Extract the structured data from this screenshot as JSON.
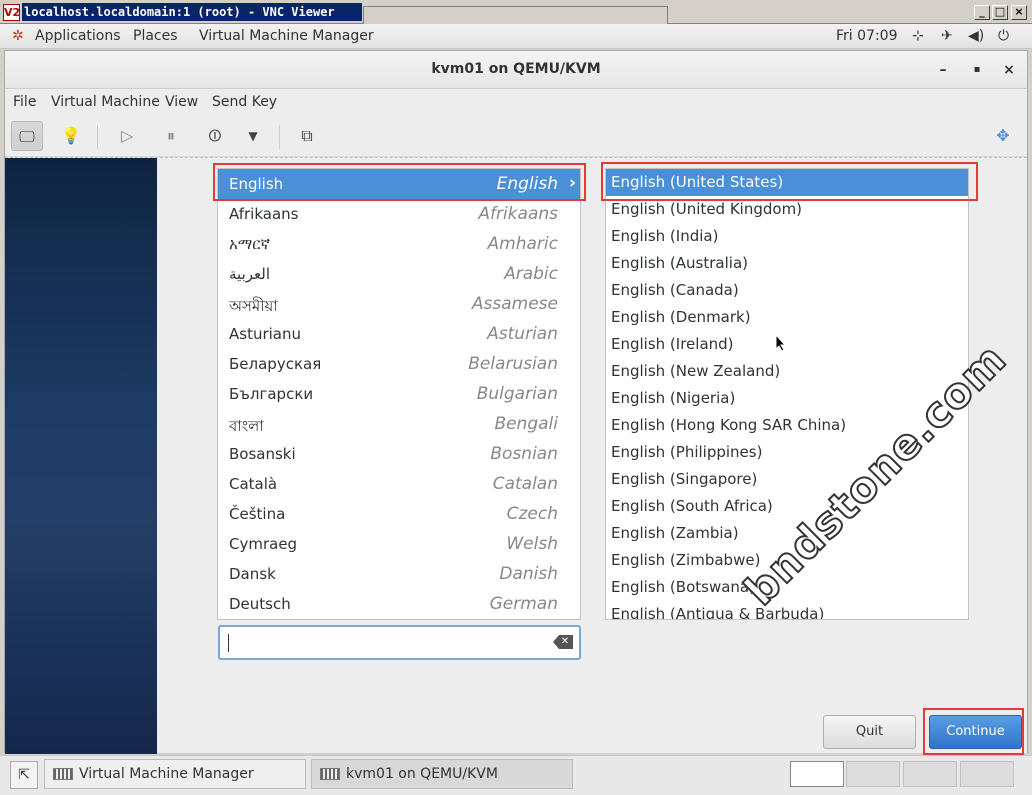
{
  "vnc": {
    "logo": "V2",
    "title": "localhost.localdomain:1 (root) - VNC Viewer",
    "controls": [
      "_",
      "□",
      "×"
    ]
  },
  "gnome_panel": {
    "applications": "Applications",
    "places": "Places",
    "virtual_machine_manager": "Virtual Machine Manager",
    "clock": "Fri 07:09",
    "icons": [
      "network-icon",
      "airplane-icon",
      "volume-icon",
      "power-icon"
    ]
  },
  "window": {
    "title": "kvm01 on QEMU/KVM",
    "controls": [
      "–",
      "▪",
      "×"
    ]
  },
  "menu": {
    "file": "File",
    "virtual_machine": "Virtual Machine",
    "view": "View",
    "send_key": "Send Key"
  },
  "languages": [
    {
      "native": "English",
      "english": "English",
      "selected": true
    },
    {
      "native": "Afrikaans",
      "english": "Afrikaans"
    },
    {
      "native": "አማርኛ",
      "english": "Amharic"
    },
    {
      "native": "العربية",
      "english": "Arabic"
    },
    {
      "native": "অসমীয়া",
      "english": "Assamese"
    },
    {
      "native": "Asturianu",
      "english": "Asturian"
    },
    {
      "native": "Беларуская",
      "english": "Belarusian"
    },
    {
      "native": "Български",
      "english": "Bulgarian"
    },
    {
      "native": "বাংলা",
      "english": "Bengali"
    },
    {
      "native": "Bosanski",
      "english": "Bosnian"
    },
    {
      "native": "Català",
      "english": "Catalan"
    },
    {
      "native": "Čeština",
      "english": "Czech"
    },
    {
      "native": "Cymraeg",
      "english": "Welsh"
    },
    {
      "native": "Dansk",
      "english": "Danish"
    },
    {
      "native": "Deutsch",
      "english": "German"
    }
  ],
  "locales": [
    "English (United States)",
    "English (United Kingdom)",
    "English (India)",
    "English (Australia)",
    "English (Canada)",
    "English (Denmark)",
    "English (Ireland)",
    "English (New Zealand)",
    "English (Nigeria)",
    "English (Hong Kong SAR China)",
    "English (Philippines)",
    "English (Singapore)",
    "English (South Africa)",
    "English (Zambia)",
    "English (Zimbabwe)",
    "English (Botswana)",
    "English (Antigua & Barbuda)"
  ],
  "search": {
    "value": ""
  },
  "buttons": {
    "quit": "Quit",
    "continue": "Continue"
  },
  "watermark": "bndstone.com",
  "taskbar": {
    "tasks": [
      "Virtual Machine Manager",
      "kvm01 on QEMU/KVM"
    ]
  },
  "colors": {
    "accent": "#4a90d9",
    "highlight": "#e43a3a"
  }
}
